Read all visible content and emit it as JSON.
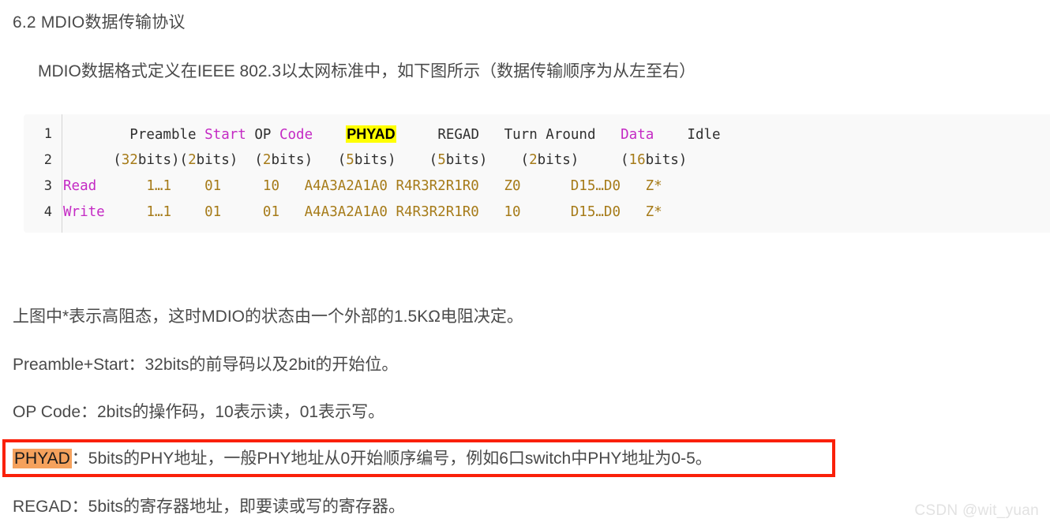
{
  "document": {
    "section_heading": "6.2 MDIO数据传输协议",
    "intro_paragraph": "MDIO数据格式定义在IEEE 802.3以太网标准中，如下图所示（数据传输顺序为从左至右）"
  },
  "code_block": {
    "line_numbers": [
      "1",
      "2",
      "3",
      "4"
    ],
    "columns": [
      "Preamble",
      "Start",
      "OP Code",
      "PHYAD",
      "REGAD",
      "Turn Around",
      "Data",
      "Idle"
    ],
    "rows": [
      {
        "line": "1",
        "tokens": [
          {
            "text": "        Preamble ",
            "type": "plain"
          },
          {
            "text": "Start",
            "type": "keyword"
          },
          {
            "text": " OP ",
            "type": "plain"
          },
          {
            "text": "Code",
            "type": "keyword"
          },
          {
            "text": "    ",
            "type": "plain"
          },
          {
            "text": "PHYAD",
            "type": "highlight"
          },
          {
            "text": "     REGAD   Turn Around   ",
            "type": "plain"
          },
          {
            "text": "Data",
            "type": "keyword"
          },
          {
            "text": "    Idle",
            "type": "plain"
          }
        ]
      },
      {
        "line": "2",
        "tokens": [
          {
            "text": "      (",
            "type": "plain"
          },
          {
            "text": "32",
            "type": "number"
          },
          {
            "text": "bits)(",
            "type": "plain"
          },
          {
            "text": "2",
            "type": "number"
          },
          {
            "text": "bits)  (",
            "type": "plain"
          },
          {
            "text": "2",
            "type": "number"
          },
          {
            "text": "bits)   (",
            "type": "plain"
          },
          {
            "text": "5",
            "type": "number"
          },
          {
            "text": "bits)    (",
            "type": "plain"
          },
          {
            "text": "5",
            "type": "number"
          },
          {
            "text": "bits)    (",
            "type": "plain"
          },
          {
            "text": "2",
            "type": "number"
          },
          {
            "text": "bits)     (",
            "type": "plain"
          },
          {
            "text": "16",
            "type": "number"
          },
          {
            "text": "bits)",
            "type": "plain"
          }
        ]
      },
      {
        "line": "3",
        "tokens": [
          {
            "text": "Read",
            "type": "keyword"
          },
          {
            "text": "      ",
            "type": "plain"
          },
          {
            "text": "1…1",
            "type": "number"
          },
          {
            "text": "    ",
            "type": "plain"
          },
          {
            "text": "01",
            "type": "number"
          },
          {
            "text": "     ",
            "type": "plain"
          },
          {
            "text": "10",
            "type": "number"
          },
          {
            "text": "   ",
            "type": "plain"
          },
          {
            "text": "A4A3A2A1A0 R4R3R2R1R0",
            "type": "number"
          },
          {
            "text": "   ",
            "type": "plain"
          },
          {
            "text": "Z0",
            "type": "number"
          },
          {
            "text": "      ",
            "type": "plain"
          },
          {
            "text": "D15…D0",
            "type": "number"
          },
          {
            "text": "   ",
            "type": "plain"
          },
          {
            "text": "Z*",
            "type": "number"
          }
        ]
      },
      {
        "line": "4",
        "tokens": [
          {
            "text": "Write",
            "type": "keyword"
          },
          {
            "text": "     ",
            "type": "plain"
          },
          {
            "text": "1…1",
            "type": "number"
          },
          {
            "text": "    ",
            "type": "plain"
          },
          {
            "text": "01",
            "type": "number"
          },
          {
            "text": "     ",
            "type": "plain"
          },
          {
            "text": "01",
            "type": "number"
          },
          {
            "text": "   ",
            "type": "plain"
          },
          {
            "text": "A4A3A2A1A0 R4R3R2R1R0",
            "type": "number"
          },
          {
            "text": "   ",
            "type": "plain"
          },
          {
            "text": "10",
            "type": "number"
          },
          {
            "text": "      ",
            "type": "plain"
          },
          {
            "text": "D15…D0",
            "type": "number"
          },
          {
            "text": "   ",
            "type": "plain"
          },
          {
            "text": "Z*",
            "type": "number"
          }
        ]
      }
    ]
  },
  "paragraphs": {
    "high_impedance": "上图中*表示高阻态，这时MDIO的状态由一个外部的1.5KΩ电阻决定。",
    "preamble_start": "Preamble+Start：32bits的前导码以及2bit的开始位。",
    "op_code": "OP Code：2bits的操作码，10表示读，01表示写。",
    "regad": "REGAD：5bits的寄存器地址，即要读或写的寄存器。"
  },
  "phyad_callout": {
    "mark_label": "PHYAD",
    "rest_text": "：5bits的PHY地址，一般PHY地址从0开始顺序编号，例如6口switch中PHY地址为0-5。"
  },
  "watermark": {
    "text": "CSDN @wit_yuan"
  },
  "colors": {
    "text": "#4a4a4a",
    "code_background": "#f9f9f9",
    "code_plain": "#2f2f2f",
    "code_keyword": "#c42ac4",
    "code_number": "#a67b19",
    "highlight_yellow": "#ffff00",
    "highlight_orange": "#f5a15c",
    "callout_border": "#fa2009",
    "watermark": "#e2e2e2"
  }
}
